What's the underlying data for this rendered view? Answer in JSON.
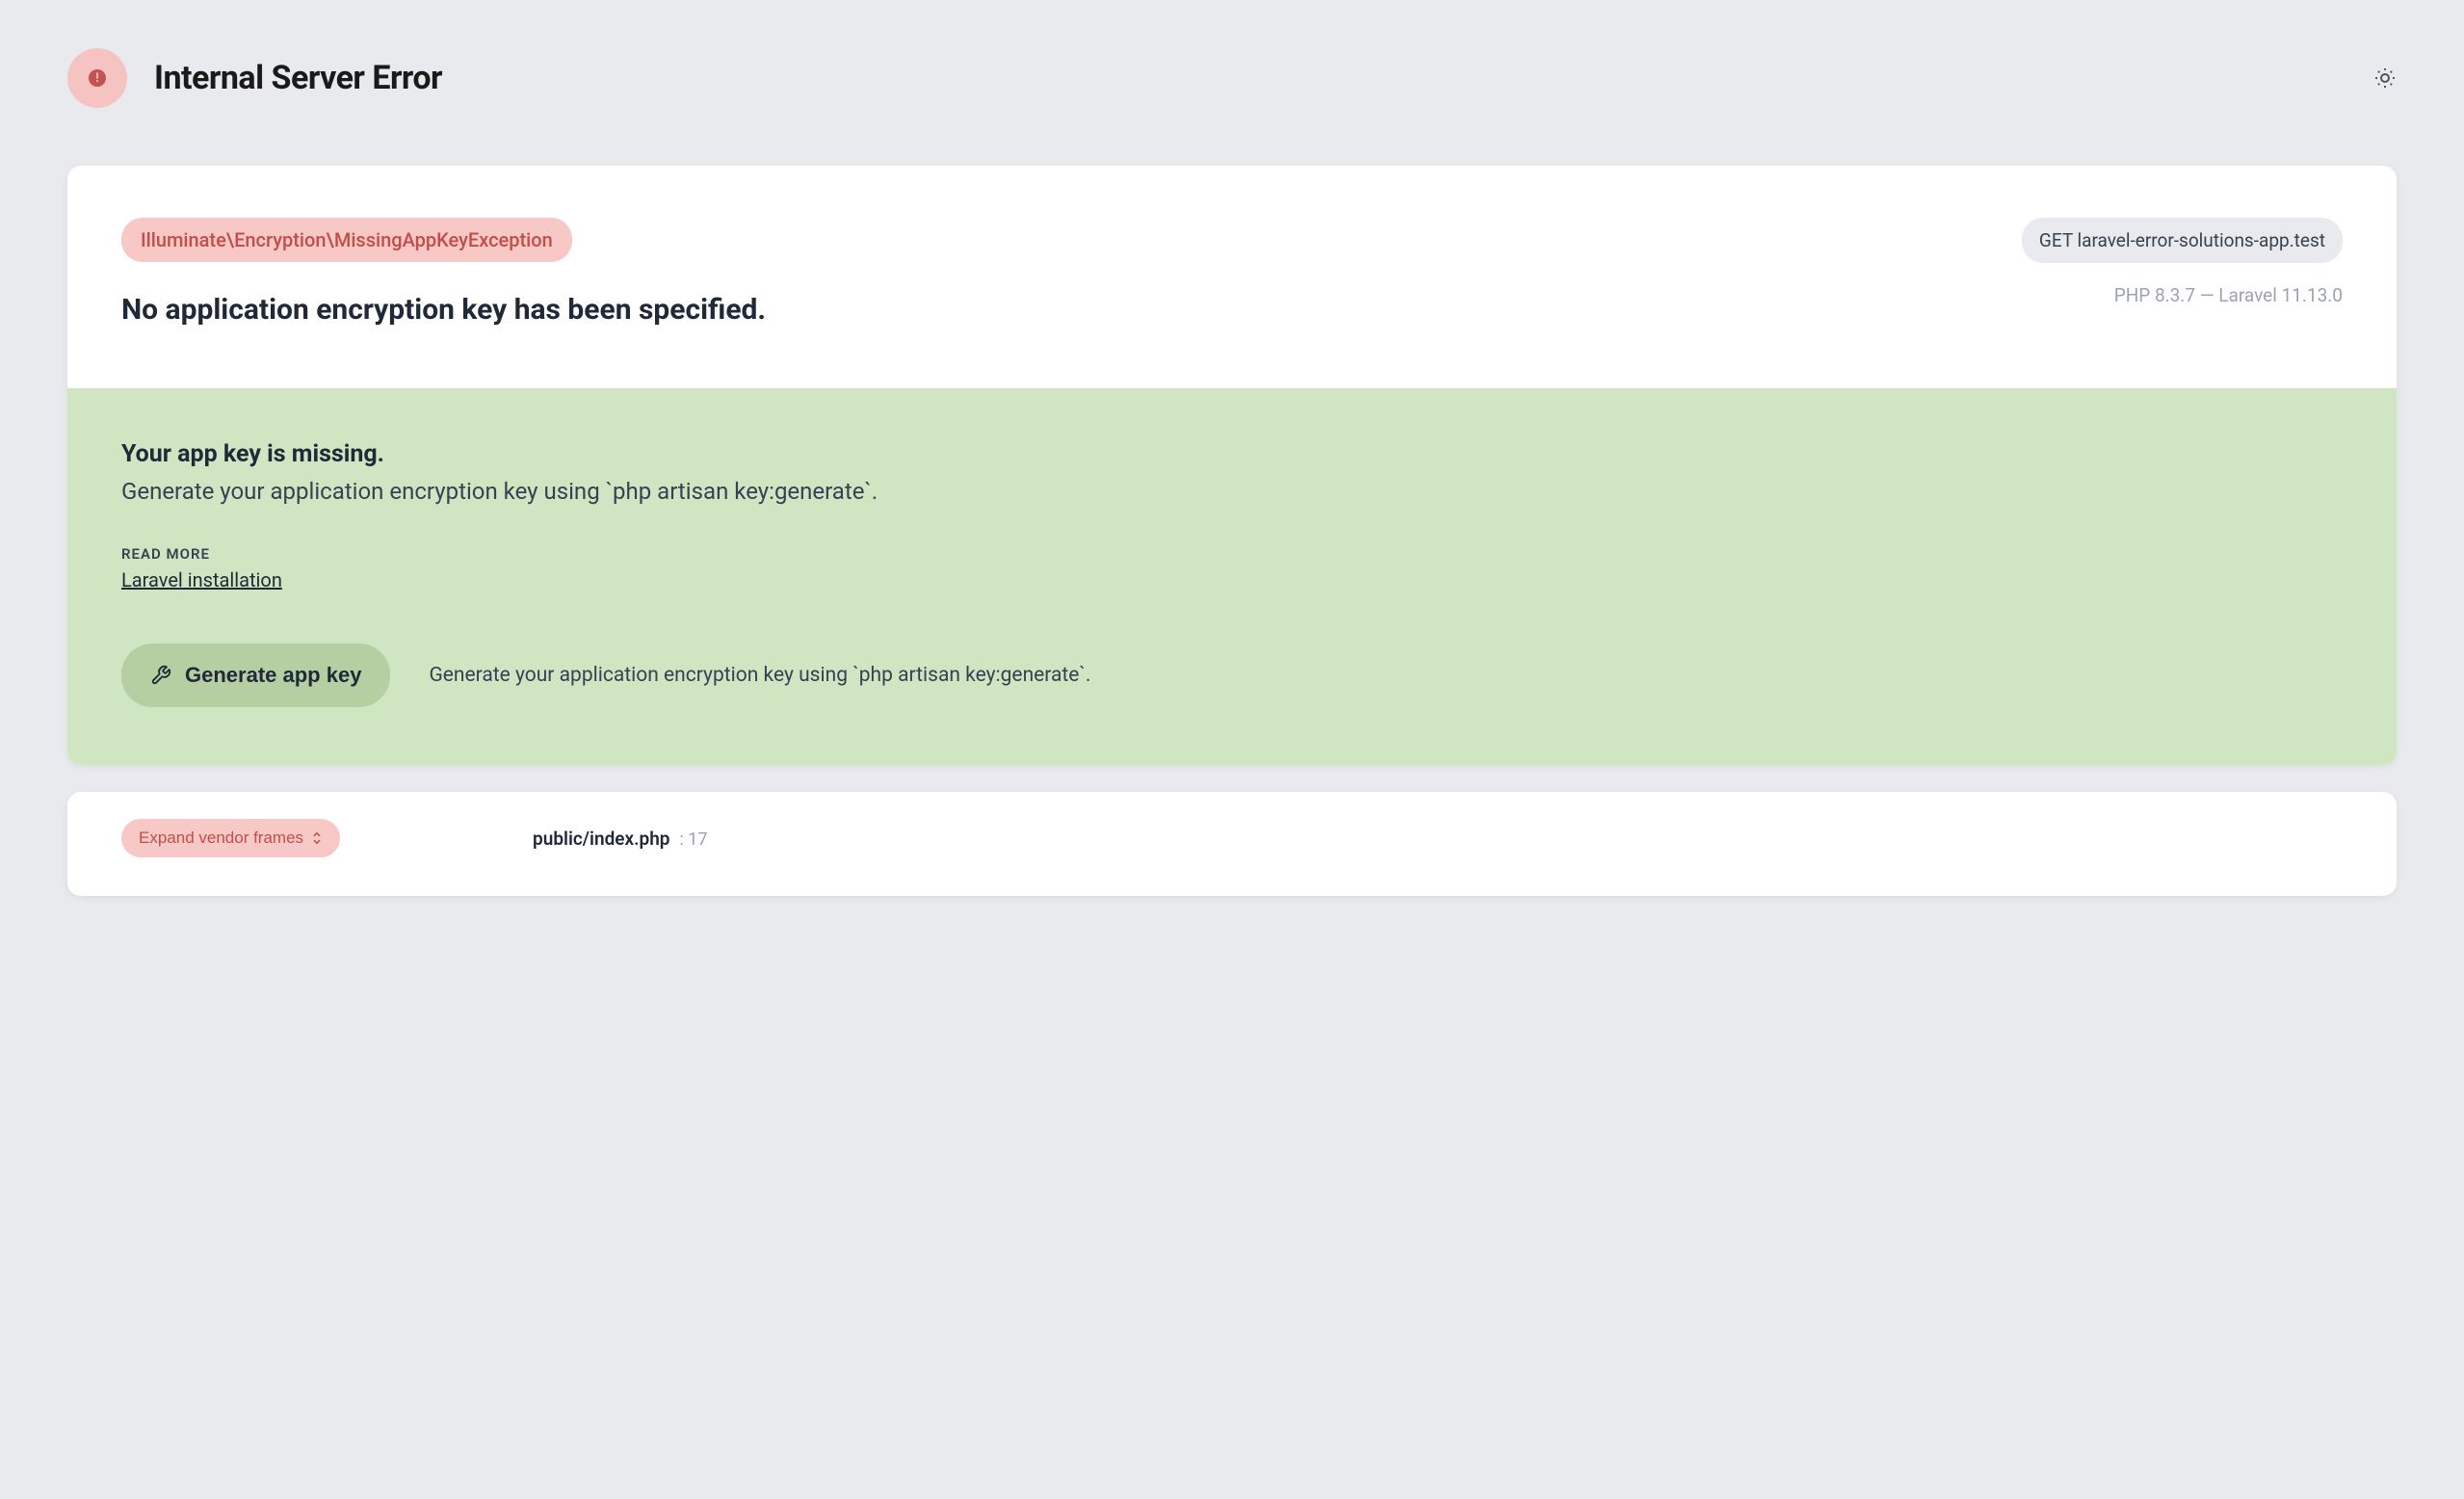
{
  "header": {
    "title": "Internal Server Error"
  },
  "exception": {
    "class": "Illuminate\\Encryption\\MissingAppKeyException",
    "message": "No application encryption key has been specified."
  },
  "request": {
    "full": "GET laravel-error-solutions-app.test"
  },
  "versions": {
    "full": "PHP 8.3.7 — Laravel 11.13.0"
  },
  "solution": {
    "title": "Your app key is missing.",
    "description": "Generate your application encryption key using `php artisan key:generate`.",
    "read_more_label": "READ MORE",
    "link_text": "Laravel installation",
    "button_label": "Generate app key",
    "action_description": "Generate your application encryption key using `php artisan key:generate`."
  },
  "trace": {
    "expand_label": "Expand vendor frames",
    "file": "public/index.php",
    "line_prefix": ":",
    "line": "17"
  }
}
